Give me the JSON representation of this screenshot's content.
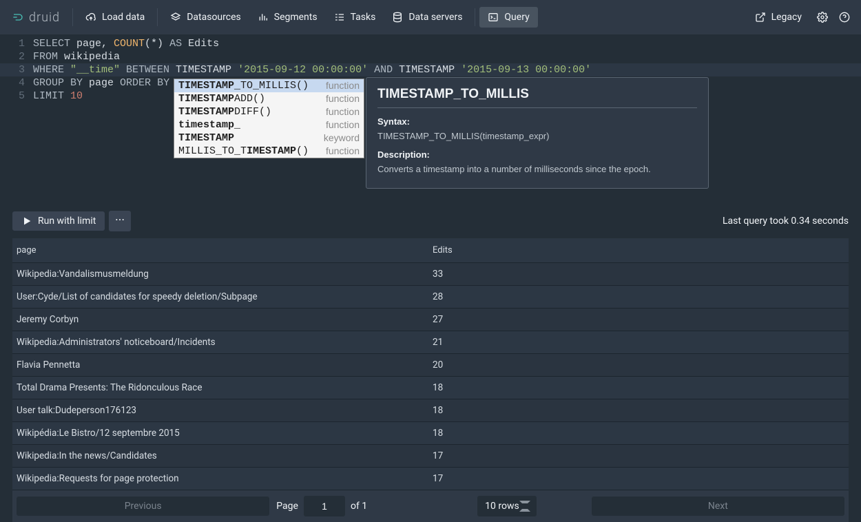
{
  "brand": "druid",
  "nav": {
    "load": "Load data",
    "datasources": "Datasources",
    "segments": "Segments",
    "tasks": "Tasks",
    "servers": "Data servers",
    "query": "Query",
    "legacy": "Legacy"
  },
  "editor": {
    "lines": [
      "1",
      "2",
      "3",
      "4",
      "5"
    ],
    "sql": {
      "l1_select": "SELECT",
      "l1_page": " page, ",
      "l1_count": "COUNT",
      "l1_star": "(*) ",
      "l1_as": "AS",
      "l1_edits": " Edits",
      "l2_from": "FROM",
      "l2_wiki": " wikipedia",
      "l3_where": "WHERE",
      "l3_time": " \"__time\" ",
      "l3_between": "BETWEEN",
      "l3_ts1": " TIMESTAMP ",
      "l3_str1": "'2015-09-12 00:00:00'",
      "l3_and": " AND",
      "l3_ts2": " TIMESTAMP ",
      "l3_str2": "'2015-09-13 00:00:00'",
      "l4_group": "GROUP",
      "l4_by1": " BY",
      "l4_page": " page ",
      "l4_order": "ORDER",
      "l4_by2": " BY",
      "l5_limit": "LIMIT ",
      "l5_num": "10"
    }
  },
  "autocomplete": [
    {
      "pre": "",
      "match": "TIMESTAMP",
      "post": "_TO_MILLIS()",
      "type": "function",
      "selected": true
    },
    {
      "pre": "",
      "match": "TIMESTAMP",
      "post": "ADD()",
      "type": "function",
      "selected": false
    },
    {
      "pre": "",
      "match": "TIMESTAMP",
      "post": "DIFF()",
      "type": "function",
      "selected": false
    },
    {
      "pre": "",
      "match": "timestamp",
      "post": "_",
      "type": "function",
      "selected": false
    },
    {
      "pre": "",
      "match": "TIMESTAMP",
      "post": "",
      "type": "keyword",
      "selected": false
    },
    {
      "pre": "MILLIS_TO_T",
      "match": "IMESTAMP",
      "post": "()",
      "type": "function",
      "selected": false
    }
  ],
  "tooltip": {
    "title": "TIMESTAMP_TO_MILLIS",
    "syntax_label": "Syntax:",
    "syntax": "TIMESTAMP_TO_MILLIS(timestamp_expr)",
    "desc_label": "Description:",
    "desc": "Converts a timestamp into a number of milliseconds since the epoch."
  },
  "toolbar": {
    "run": "Run with limit",
    "status": "Last query took 0.34 seconds"
  },
  "results": {
    "headers": {
      "page": "page",
      "edits": "Edits"
    },
    "rows": [
      {
        "page": "Wikipedia:Vandalismusmeldung",
        "edits": "33"
      },
      {
        "page": "User:Cyde/List of candidates for speedy deletion/Subpage",
        "edits": "28"
      },
      {
        "page": "Jeremy Corbyn",
        "edits": "27"
      },
      {
        "page": "Wikipedia:Administrators' noticeboard/Incidents",
        "edits": "21"
      },
      {
        "page": "Flavia Pennetta",
        "edits": "20"
      },
      {
        "page": "Total Drama Presents: The Ridonculous Race",
        "edits": "18"
      },
      {
        "page": "User talk:Dudeperson176123",
        "edits": "18"
      },
      {
        "page": "Wikipédia:Le Bistro/12 septembre 2015",
        "edits": "18"
      },
      {
        "page": "Wikipedia:In the news/Candidates",
        "edits": "17"
      },
      {
        "page": "Wikipedia:Requests for page protection",
        "edits": "17"
      }
    ]
  },
  "pagination": {
    "prev": "Previous",
    "next": "Next",
    "page_label": "Page",
    "page_value": "1",
    "of_label": "of 1",
    "rows": "10 rows"
  }
}
